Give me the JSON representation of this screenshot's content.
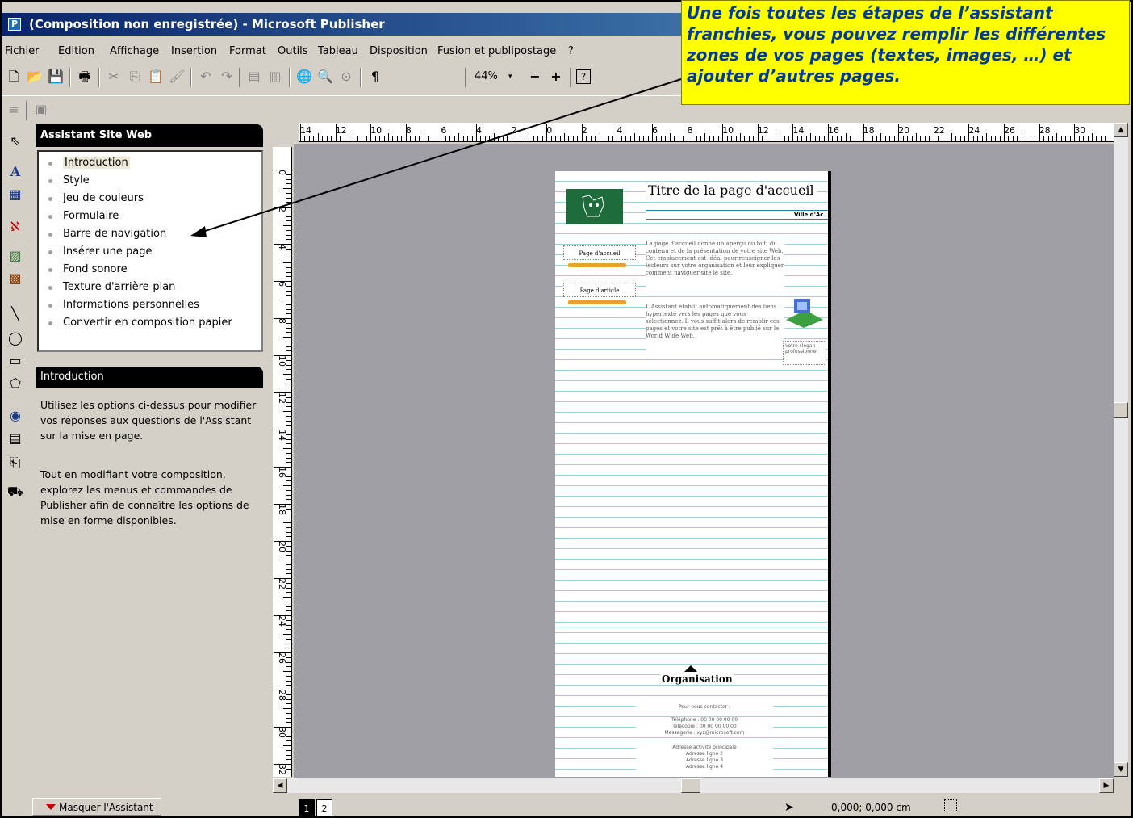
{
  "window": {
    "title": "(Composition non enregistrée) - Microsoft Publisher"
  },
  "menu": [
    "Fichier",
    "Edition",
    "Affichage",
    "Insertion",
    "Format",
    "Outils",
    "Tableau",
    "Disposition",
    "Fusion et publipostage",
    "?"
  ],
  "toolbar": {
    "zoom": "44%"
  },
  "wizard": {
    "title": "Assistant Site Web",
    "items": [
      "Introduction",
      "Style",
      "Jeu de couleurs",
      "Formulaire",
      "Barre de navigation",
      "Insérer une page",
      "Fond sonore",
      "Texture d'arrière-plan",
      "Informations personnelles",
      "Convertir en composition papier"
    ],
    "section_title": "Introduction",
    "desc1": "Utilisez les options ci-dessus pour modifier vos réponses aux questions de l'Assistant sur la mise en page.",
    "desc2": "Tout en modifiant votre composition, explorez les menus et commandes de Publisher afin de connaître les options de mise en forme disponibles.",
    "hide_label": "Masquer l'Assistant"
  },
  "ruler": {
    "h_labels": [
      "14",
      "12",
      "10",
      "8",
      "6",
      "4",
      "2",
      "0",
      "2",
      "4",
      "6",
      "8",
      "10",
      "12",
      "14",
      "16",
      "18",
      "20",
      "22",
      "24",
      "26",
      "28",
      "30"
    ],
    "v_labels": [
      "0",
      "2",
      "4",
      "6",
      "8",
      "10",
      "12",
      "14",
      "16",
      "18",
      "20",
      "22",
      "24",
      "26",
      "28",
      "30",
      "32"
    ]
  },
  "page": {
    "title": "Titre de la page d'accueil",
    "city": "Ville d'Ac",
    "nav1": "Page d'accueil",
    "nav2": "Page d'article",
    "text1": "La page d'accueil donne un aperçu du but, du contenu et de la présentation de votre site Web. Cet emplacement est idéal pour renseigner les lecteurs sur votre organisation et leur expliquer comment naviguer site le site.",
    "text2": "L'Assistant établit automatiquement des liens hypertexte vers les pages que vous sélectionnez. Il vous suffit alors de remplir ces pages et votre site est prêt à être publié sur le World Wide Web.",
    "slogan": "Votre slogan professionnel",
    "org": "Organisation",
    "contact1": "Pour nous contacter :",
    "contact2": "Téléphone : 00 00 00 00 00",
    "contact3": "Télécopie : 00 00 00 00 00",
    "contact4": "Messagerie : xyz@microsoft.com",
    "addr1": "Adresse activité principale",
    "addr2": "Adresse ligne 2",
    "addr3": "Adresse ligne 3",
    "addr4": "Adresse ligne 4"
  },
  "callout": {
    "text": "Une fois toutes les étapes de l’assistant franchies, vous pouvez remplir les différentes zones de vos pages (textes, images, …) et ajouter d’autres pages."
  },
  "status": {
    "page1": "1",
    "page2": "2",
    "coords": "0,000; 0,000 cm"
  }
}
